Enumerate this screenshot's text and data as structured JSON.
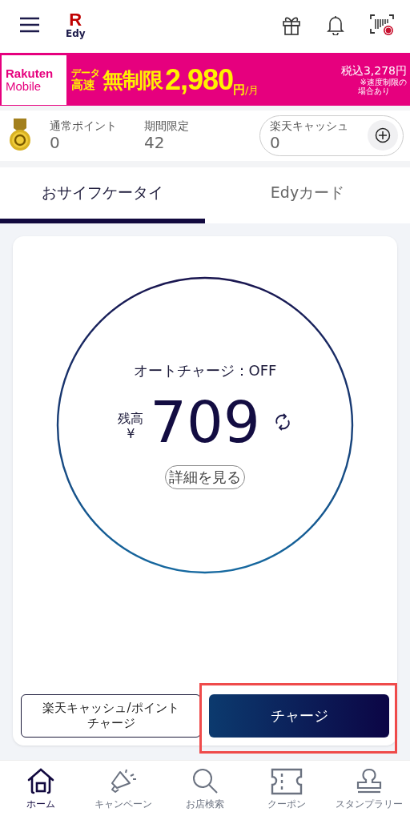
{
  "header": {
    "logo_letter": "R",
    "logo_text": "Edy"
  },
  "banner": {
    "brand_top": "Rakuten",
    "brand_bottom": "Mobile",
    "tag_top": "データ",
    "tag_bottom": "高速",
    "headline": "無制限",
    "price": "2,980",
    "currency": "円",
    "per": "/月",
    "tax_price": "税込3,278円",
    "note_line1": "※速度制限の",
    "note_line2": "場合あり"
  },
  "points": [
    {
      "label": "通常ポイント",
      "value": "0"
    },
    {
      "label": "期間限定",
      "value": "42"
    }
  ],
  "cash": {
    "label": "楽天キャッシュ",
    "value": "0"
  },
  "tabs": [
    {
      "label": "おサイフケータイ",
      "selected": true
    },
    {
      "label": "Edyカード",
      "selected": false
    }
  ],
  "balance": {
    "auto_charge": "オートチャージ：OFF",
    "label": "残高",
    "currency": "¥",
    "amount": "709",
    "details": "詳細を見る"
  },
  "actions": [
    {
      "label": "楽天キャッシュ/ポイントチャージ",
      "kind": "outline",
      "highlighted": false
    },
    {
      "label": "チャージ",
      "kind": "primary",
      "highlighted": true
    }
  ],
  "nav": [
    {
      "label": "ホーム",
      "kind": "home",
      "selected": true
    },
    {
      "label": "キャンペーン",
      "kind": "megaphone",
      "selected": false
    },
    {
      "label": "お店検索",
      "kind": "search",
      "selected": false
    },
    {
      "label": "クーポン",
      "kind": "ticket",
      "selected": false
    },
    {
      "label": "スタンプラリー",
      "kind": "stamp",
      "selected": false
    }
  ]
}
